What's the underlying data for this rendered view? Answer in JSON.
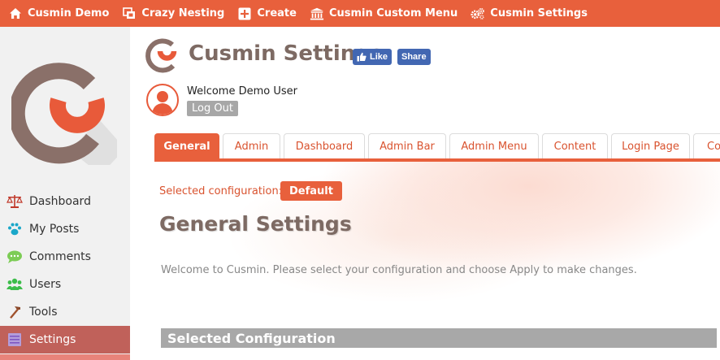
{
  "topbar": {
    "items": [
      {
        "label": "Cusmin Demo",
        "icon": "home-icon"
      },
      {
        "label": "Crazy Nesting",
        "icon": "nesting-icon"
      },
      {
        "label": "Create",
        "icon": "plus-icon"
      },
      {
        "label": "Cusmin Custom Menu",
        "icon": "bank-icon"
      },
      {
        "label": "Cusmin Settings",
        "icon": "gears-icon"
      }
    ]
  },
  "sidebar": {
    "items": [
      {
        "label": "Dashboard",
        "icon": "scales-icon"
      },
      {
        "label": "My Posts",
        "icon": "paw-icon"
      },
      {
        "label": "Comments",
        "icon": "speech-bubble-icon"
      },
      {
        "label": "Users",
        "icon": "users-icon"
      },
      {
        "label": "Tools",
        "icon": "hammer-icon"
      },
      {
        "label": "Settings",
        "icon": "list-icon"
      }
    ],
    "active": "Settings"
  },
  "header": {
    "title": "Cusmin Settings",
    "like_label": "Like",
    "share_label": "Share",
    "welcome": "Welcome Demo User",
    "logout_label": "Log Out"
  },
  "tabs": [
    {
      "label": "General",
      "active": true
    },
    {
      "label": "Admin",
      "active": false
    },
    {
      "label": "Dashboard",
      "active": false
    },
    {
      "label": "Admin Bar",
      "active": false
    },
    {
      "label": "Admin Menu",
      "active": false
    },
    {
      "label": "Content",
      "active": false
    },
    {
      "label": "Login Page",
      "active": false
    },
    {
      "label": "Col",
      "active": false
    }
  ],
  "main": {
    "selected_config_label": "Selected configuration:",
    "selected_config_value": "Default",
    "section_title": "General Settings",
    "intro": "Welcome to Cusmin. Please select your configuration and choose Apply to make changes.",
    "config_bar_title": "Selected Configuration"
  },
  "colors": {
    "accent": "#e8603c",
    "brand_brown": "#7d6a63",
    "facebook": "#4267b2",
    "sidebar_active": "#c0615a"
  }
}
